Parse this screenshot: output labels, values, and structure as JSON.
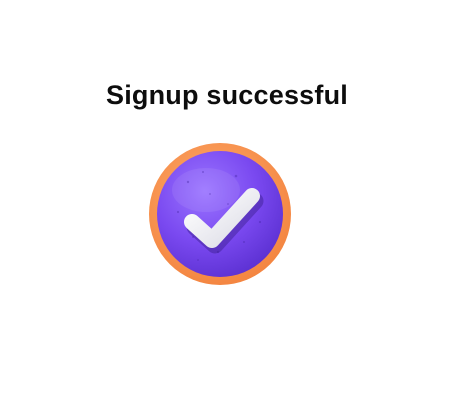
{
  "message": {
    "title": "Signup successful"
  },
  "badge": {
    "icon": "check-icon",
    "ring_color": "#F5914B",
    "fill_color": "#7B4BF0",
    "check_color": "#F4F4F8"
  }
}
